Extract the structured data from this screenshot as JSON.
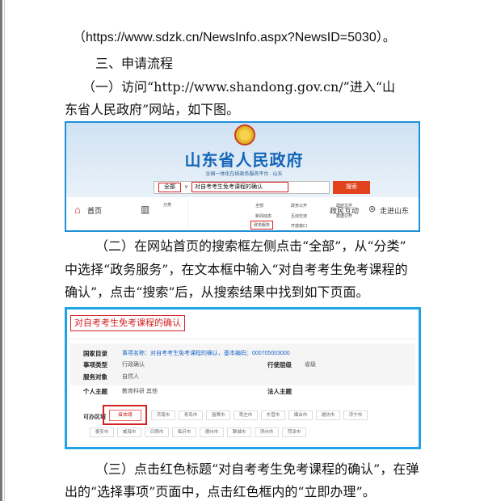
{
  "doc": {
    "url_line": "（https://www.sdzk.cn/NewsInfo.aspx?NewsID=5030）。",
    "section_heading": "三、申请流程",
    "step1_line1": "（一）访问“http://www.shandong.gov.cn/”进入“山",
    "step1_line2": "东省人民政府”网站，如下图。",
    "step2_line1": "（二）在网站首页的搜索框左侧点击“全部”，从“分类”",
    "step2_line2": "中选择“政务服务”，在文本框中输入“对自考考生免考课程的",
    "step2_line3": "确认”，点击“搜索”后，从搜索结果中找到如下页面。",
    "step3_line1": "（三）点击红色标题“对自考考生免考课程的确认”，在弹",
    "step3_line2": "出的“选择事项”页面中，点击红色框内的“立即办理”。"
  },
  "fig1": {
    "portal_title": "山东省人民政府",
    "portal_subtitle": "全国一体化在线政务服务平台 · 山东",
    "search_scope": "全部",
    "search_caret": "∨",
    "search_query": "对自考考生免考课程的确认",
    "search_button": "搜索",
    "nav_home": "首页",
    "nav_interact": "政民互动",
    "nav_visit": "走进山东",
    "menu": {
      "classify": "分类",
      "all": "全部",
      "gov_public": "政务公开",
      "gov_docs": "政府文件",
      "news": "新闻动态",
      "interact": "互动交流",
      "data": "数据公开",
      "gov_service": "政务服务",
      "open_window": "开放窗口"
    },
    "colors": {
      "border": "#1f8fd8",
      "title": "#1565b8",
      "search_button": "#e2431d",
      "highlight": "#d32020"
    }
  },
  "fig2": {
    "title": "对自考考生免考课程的确认",
    "catalog_label": "国家目录",
    "catalog_value": "事项名称：对自考考生免考课程的确认，基本编码：000705003000",
    "type_label": "事项类型",
    "type_value": "行政确认",
    "level_label": "行使层级",
    "level_value": "省级",
    "target_label": "服务对象",
    "target_value": "自然人",
    "topic_label": "个人主题",
    "topic_value": "教育科研 其他",
    "legal_label": "法人主题",
    "region_label": "可办区域",
    "province": "省本级",
    "cities_row1": [
      "济南市",
      "青岛市",
      "淄博市",
      "枣庄市",
      "东营市",
      "烟台市",
      "潍坊市",
      "济宁市"
    ],
    "cities_row2": [
      "泰安市",
      "威海市",
      "日照市",
      "临沂市",
      "德州市",
      "聊城市",
      "滨州市",
      "菏泽市"
    ],
    "colors": {
      "border": "#1ea3e6",
      "highlight": "#d32020",
      "link": "#1a66c9"
    }
  }
}
